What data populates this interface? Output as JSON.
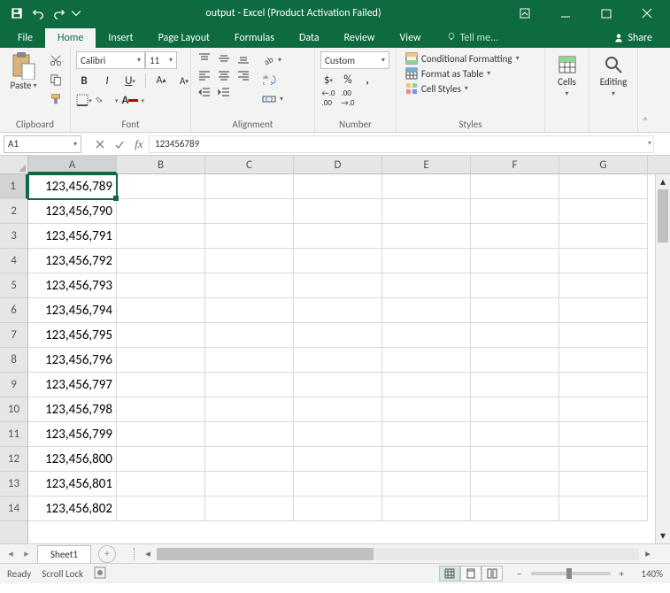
{
  "titlebar": {
    "title": "output - Excel (Product Activation Failed)"
  },
  "tabs": {
    "file": "File",
    "items": [
      "Home",
      "Insert",
      "Page Layout",
      "Formulas",
      "Data",
      "Review",
      "View"
    ],
    "active_index": 0,
    "tell_me": "Tell me...",
    "share": "Share"
  },
  "ribbon": {
    "clipboard": {
      "label": "Clipboard",
      "paste": "Paste"
    },
    "font": {
      "label": "Font",
      "name": "Calibri",
      "size": "11",
      "fill_color": "#ffff00",
      "font_color": "#c00000"
    },
    "alignment": {
      "label": "Alignment"
    },
    "number": {
      "label": "Number",
      "format": "Custom"
    },
    "styles": {
      "label": "Styles",
      "conditional": "Conditional Formatting",
      "table": "Format as Table",
      "cell": "Cell Styles"
    },
    "cells": {
      "label": "Cells",
      "btn": "Cells"
    },
    "editing": {
      "label": "Editing",
      "btn": "Editing"
    }
  },
  "formula_bar": {
    "name_box": "A1",
    "value": "123456789"
  },
  "grid": {
    "columns": [
      "A",
      "B",
      "C",
      "D",
      "E",
      "F",
      "G"
    ],
    "active_col": 0,
    "active_row": 0,
    "rows": [
      {
        "num": "1",
        "cells": [
          "123,456,789",
          "",
          "",
          "",
          "",
          "",
          ""
        ]
      },
      {
        "num": "2",
        "cells": [
          "123,456,790",
          "",
          "",
          "",
          "",
          "",
          ""
        ]
      },
      {
        "num": "3",
        "cells": [
          "123,456,791",
          "",
          "",
          "",
          "",
          "",
          ""
        ]
      },
      {
        "num": "4",
        "cells": [
          "123,456,792",
          "",
          "",
          "",
          "",
          "",
          ""
        ]
      },
      {
        "num": "5",
        "cells": [
          "123,456,793",
          "",
          "",
          "",
          "",
          "",
          ""
        ]
      },
      {
        "num": "6",
        "cells": [
          "123,456,794",
          "",
          "",
          "",
          "",
          "",
          ""
        ]
      },
      {
        "num": "7",
        "cells": [
          "123,456,795",
          "",
          "",
          "",
          "",
          "",
          ""
        ]
      },
      {
        "num": "8",
        "cells": [
          "123,456,796",
          "",
          "",
          "",
          "",
          "",
          ""
        ]
      },
      {
        "num": "9",
        "cells": [
          "123,456,797",
          "",
          "",
          "",
          "",
          "",
          ""
        ]
      },
      {
        "num": "10",
        "cells": [
          "123,456,798",
          "",
          "",
          "",
          "",
          "",
          ""
        ]
      },
      {
        "num": "11",
        "cells": [
          "123,456,799",
          "",
          "",
          "",
          "",
          "",
          ""
        ]
      },
      {
        "num": "12",
        "cells": [
          "123,456,800",
          "",
          "",
          "",
          "",
          "",
          ""
        ]
      },
      {
        "num": "13",
        "cells": [
          "123,456,801",
          "",
          "",
          "",
          "",
          "",
          ""
        ]
      },
      {
        "num": "14",
        "cells": [
          "123,456,802",
          "",
          "",
          "",
          "",
          "",
          ""
        ]
      }
    ]
  },
  "sheet_tabs": {
    "active": "Sheet1"
  },
  "status": {
    "ready": "Ready",
    "scroll_lock": "Scroll Lock",
    "zoom": "140%"
  }
}
